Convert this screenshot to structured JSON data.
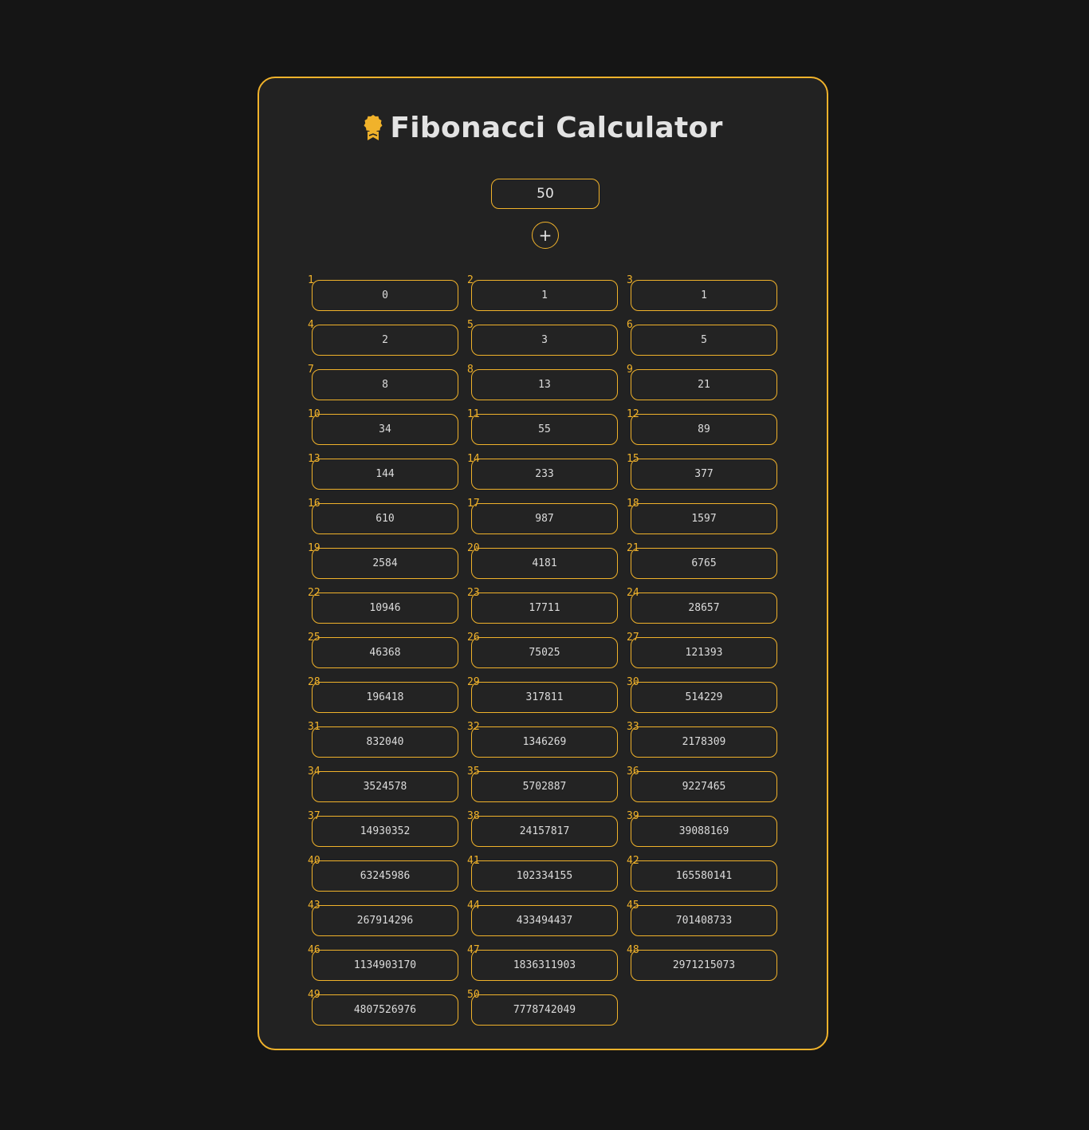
{
  "app": {
    "title": "Fibonacci Calculator",
    "icon": "medal-icon",
    "accent_color": "#f0b22b",
    "background_color": "#151515",
    "card_color": "#222222"
  },
  "input": {
    "value": "50"
  },
  "add_button": {
    "label": "+"
  },
  "results": [
    {
      "index": "1",
      "value": "0"
    },
    {
      "index": "2",
      "value": "1"
    },
    {
      "index": "3",
      "value": "1"
    },
    {
      "index": "4",
      "value": "2"
    },
    {
      "index": "5",
      "value": "3"
    },
    {
      "index": "6",
      "value": "5"
    },
    {
      "index": "7",
      "value": "8"
    },
    {
      "index": "8",
      "value": "13"
    },
    {
      "index": "9",
      "value": "21"
    },
    {
      "index": "10",
      "value": "34"
    },
    {
      "index": "11",
      "value": "55"
    },
    {
      "index": "12",
      "value": "89"
    },
    {
      "index": "13",
      "value": "144"
    },
    {
      "index": "14",
      "value": "233"
    },
    {
      "index": "15",
      "value": "377"
    },
    {
      "index": "16",
      "value": "610"
    },
    {
      "index": "17",
      "value": "987"
    },
    {
      "index": "18",
      "value": "1597"
    },
    {
      "index": "19",
      "value": "2584"
    },
    {
      "index": "20",
      "value": "4181"
    },
    {
      "index": "21",
      "value": "6765"
    },
    {
      "index": "22",
      "value": "10946"
    },
    {
      "index": "23",
      "value": "17711"
    },
    {
      "index": "24",
      "value": "28657"
    },
    {
      "index": "25",
      "value": "46368"
    },
    {
      "index": "26",
      "value": "75025"
    },
    {
      "index": "27",
      "value": "121393"
    },
    {
      "index": "28",
      "value": "196418"
    },
    {
      "index": "29",
      "value": "317811"
    },
    {
      "index": "30",
      "value": "514229"
    },
    {
      "index": "31",
      "value": "832040"
    },
    {
      "index": "32",
      "value": "1346269"
    },
    {
      "index": "33",
      "value": "2178309"
    },
    {
      "index": "34",
      "value": "3524578"
    },
    {
      "index": "35",
      "value": "5702887"
    },
    {
      "index": "36",
      "value": "9227465"
    },
    {
      "index": "37",
      "value": "14930352"
    },
    {
      "index": "38",
      "value": "24157817"
    },
    {
      "index": "39",
      "value": "39088169"
    },
    {
      "index": "40",
      "value": "63245986"
    },
    {
      "index": "41",
      "value": "102334155"
    },
    {
      "index": "42",
      "value": "165580141"
    },
    {
      "index": "43",
      "value": "267914296"
    },
    {
      "index": "44",
      "value": "433494437"
    },
    {
      "index": "45",
      "value": "701408733"
    },
    {
      "index": "46",
      "value": "1134903170"
    },
    {
      "index": "47",
      "value": "1836311903"
    },
    {
      "index": "48",
      "value": "2971215073"
    },
    {
      "index": "49",
      "value": "4807526976"
    },
    {
      "index": "50",
      "value": "7778742049"
    }
  ]
}
